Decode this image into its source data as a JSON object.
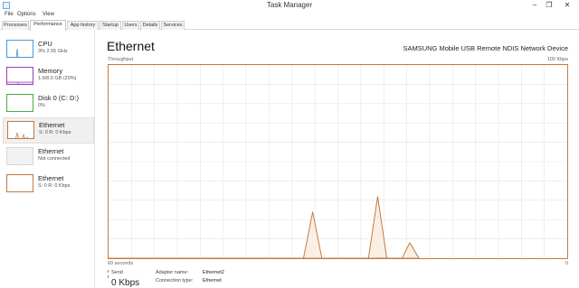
{
  "window": {
    "title": "Task Manager"
  },
  "menu": [
    "File",
    "Options",
    "View"
  ],
  "tabs": [
    "Processes",
    "Performance",
    "App history",
    "Startup",
    "Users",
    "Details",
    "Services"
  ],
  "sidebar": [
    {
      "name": "CPU",
      "sub": "3%  2.55 GHz",
      "color": "#4a97d4"
    },
    {
      "name": "Memory",
      "sub": "1.6/8.0 GB (20%)",
      "color": "#9b3fba"
    },
    {
      "name": "Disk 0 (C: D:)",
      "sub": "0%",
      "color": "#4ba846"
    },
    {
      "name": "Ethernet",
      "sub": "S: 0 R: 0 Kbps",
      "color": "#c17a3e"
    },
    {
      "name": "Ethernet",
      "sub": "Not connected",
      "color": "#bfbfbf"
    },
    {
      "name": "Ethernet",
      "sub": "S: 0 R: 0 Kbps",
      "color": "#c17a3e"
    }
  ],
  "main": {
    "title": "Ethernet",
    "device": "SAMSUNG Mobile USB Remote NDIS Network Device",
    "y_label": "Throughput",
    "y_max": "100 Kbps",
    "x_left": "60 seconds",
    "x_right": "0"
  },
  "details": {
    "send_label": "Send",
    "send_value": "0 Kbps",
    "adapter_label": "Adapter name:",
    "adapter_value": "Ethernet2",
    "conn_label": "Connection type:",
    "conn_value": "Ethernet"
  },
  "colors": {
    "accent": "#c17a3e",
    "fill": "#fbeee3"
  },
  "chart_data": {
    "type": "area",
    "x_range": [
      60,
      0
    ],
    "y_range": [
      0,
      100
    ],
    "series": [
      {
        "x": [
          60,
          34.5,
          33.3,
          32.1,
          26.0,
          24.8,
          23.6,
          24.9,
          21.6,
          20.6,
          19.4
        ],
        "y": [
          0,
          0,
          24,
          0,
          0,
          32,
          0,
          0,
          0,
          8,
          0
        ]
      }
    ],
    "grid": true
  }
}
